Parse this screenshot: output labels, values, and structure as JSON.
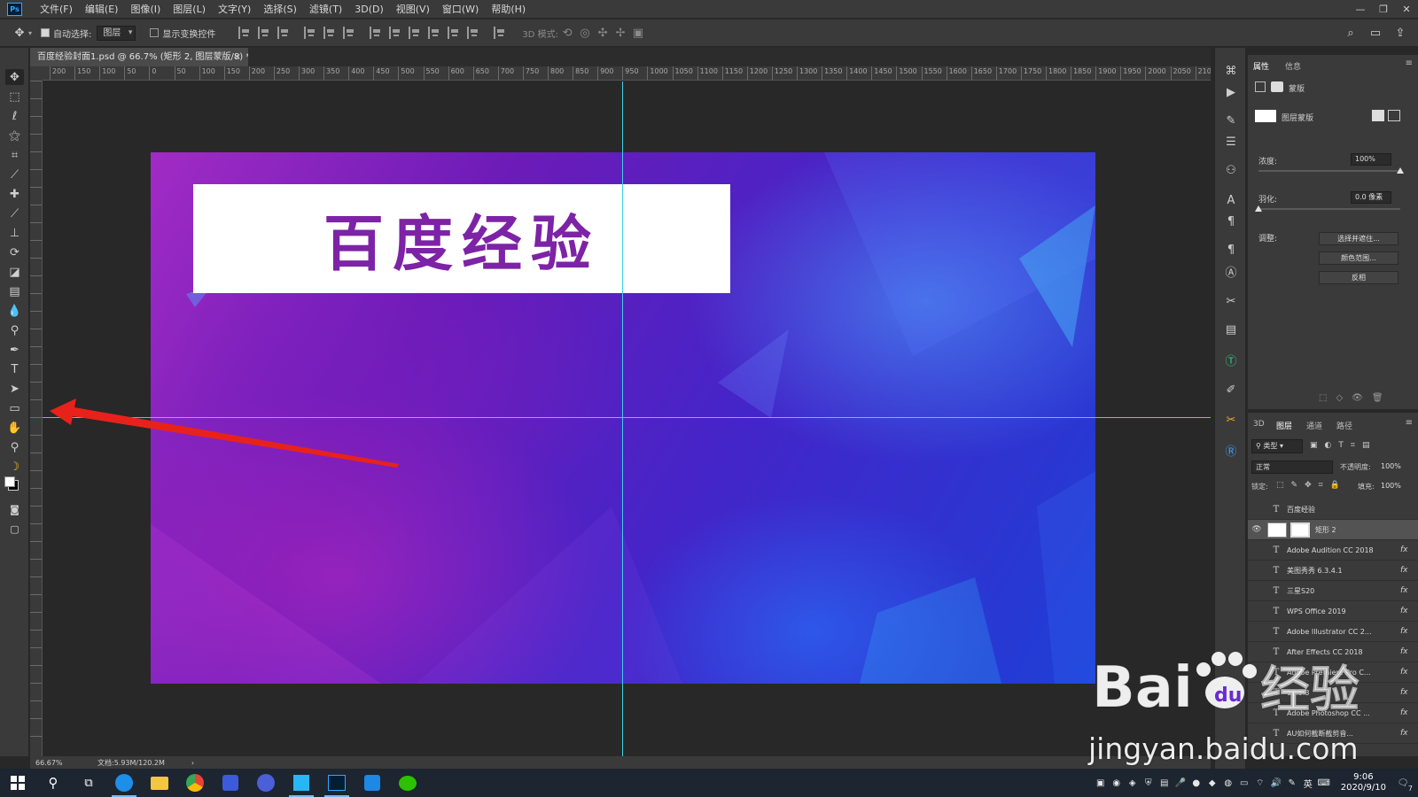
{
  "app": {
    "logo": "Ps"
  },
  "menu": [
    "文件(F)",
    "编辑(E)",
    "图像(I)",
    "图层(L)",
    "文字(Y)",
    "选择(S)",
    "滤镜(T)",
    "3D(D)",
    "视图(V)",
    "窗口(W)",
    "帮助(H)"
  ],
  "options": {
    "auto_select_label": "自动选择:",
    "auto_select_value": "图层",
    "show_transform_label": "显示变换控件",
    "mode_3d_label": "3D 模式:"
  },
  "document": {
    "tab_title": "百度经验封面1.psd @ 66.7% (矩形 2, 图层蒙版/8) *",
    "zoom": "66.67%",
    "doc_size": "文档:5.93M/120.2M"
  },
  "ruler_ticks": [
    "200",
    "150",
    "100",
    "50",
    "0",
    "50",
    "100",
    "150",
    "200",
    "250",
    "300",
    "350",
    "400",
    "450",
    "500",
    "550",
    "600",
    "650",
    "700",
    "750",
    "800",
    "850",
    "900",
    "950",
    "1000",
    "1050",
    "1100",
    "1150",
    "1200",
    "1250",
    "1300",
    "1350",
    "1400",
    "1450",
    "1500",
    "1550",
    "1600",
    "1650",
    "1700",
    "1750",
    "1800",
    "1850",
    "1900",
    "1950",
    "2000",
    "2050",
    "2100"
  ],
  "canvas": {
    "title": "百度经验"
  },
  "properties": {
    "tab_properties": "属性",
    "tab_info": "信息",
    "mask_header": "蒙版",
    "layer_mask_label": "图层蒙版",
    "density_label": "浓度:",
    "density_value": "100%",
    "density": 1.0,
    "feather_label": "羽化:",
    "feather_value": "0.0 像素",
    "feather": 0.0,
    "adjust_label": "调整:",
    "btn_select_mask": "选择并遮住...",
    "btn_color_range": "颜色范围...",
    "btn_invert": "反相"
  },
  "layers_panel": {
    "tab_3d": "3D",
    "tab_layers": "图层",
    "tab_channels": "通道",
    "tab_paths": "路径",
    "filter_kind": "类型",
    "blend_mode": "正常",
    "opacity_label": "不透明度:",
    "opacity_value": "100%",
    "lock_label": "锁定:",
    "fill_label": "填充:",
    "fill_value": "100%",
    "layers": [
      {
        "name": "百度经验",
        "type": "T",
        "fx": "",
        "selected": false,
        "visible": false
      },
      {
        "name": "矩形 2",
        "type": "shape",
        "fx": "",
        "selected": true,
        "visible": true
      },
      {
        "name": "Adobe Audition CC 2018",
        "type": "T",
        "fx": "fx",
        "selected": false,
        "visible": false
      },
      {
        "name": "美图秀秀 6.3.4.1",
        "type": "T",
        "fx": "fx",
        "selected": false,
        "visible": false
      },
      {
        "name": "三星S20",
        "type": "T",
        "fx": "fx",
        "selected": false,
        "visible": false
      },
      {
        "name": "WPS Office 2019",
        "type": "T",
        "fx": "fx",
        "selected": false,
        "visible": false
      },
      {
        "name": "Adobe Illustrator CC 2...",
        "type": "T",
        "fx": "fx",
        "selected": false,
        "visible": false
      },
      {
        "name": "After Effects CC 2018",
        "type": "T",
        "fx": "fx",
        "selected": false,
        "visible": false
      },
      {
        "name": "Adobe Premiere Pro C...",
        "type": "T",
        "fx": "fx",
        "selected": false,
        "visible": false
      },
      {
        "name": "10.5.3",
        "type": "T",
        "fx": "fx",
        "selected": false,
        "visible": false
      },
      {
        "name": "Adobe Photoshop CC ...",
        "type": "T",
        "fx": "fx",
        "selected": false,
        "visible": false
      },
      {
        "name": "AU如何截断截剪音...",
        "type": "T",
        "fx": "fx",
        "selected": false,
        "visible": false
      }
    ]
  },
  "watermark": {
    "logo_text": "Bai",
    "logo_cn": "经验",
    "url": "jingyan.baidu.com"
  },
  "taskbar": {
    "ime": "英",
    "time": "9:06",
    "date": "2020/9/10",
    "notification_count": "7"
  },
  "colors": {
    "accent": "#31a8ff",
    "guide": "#3fd0e8",
    "title_purple": "#7d23a6",
    "arrow": "#e8221a"
  }
}
